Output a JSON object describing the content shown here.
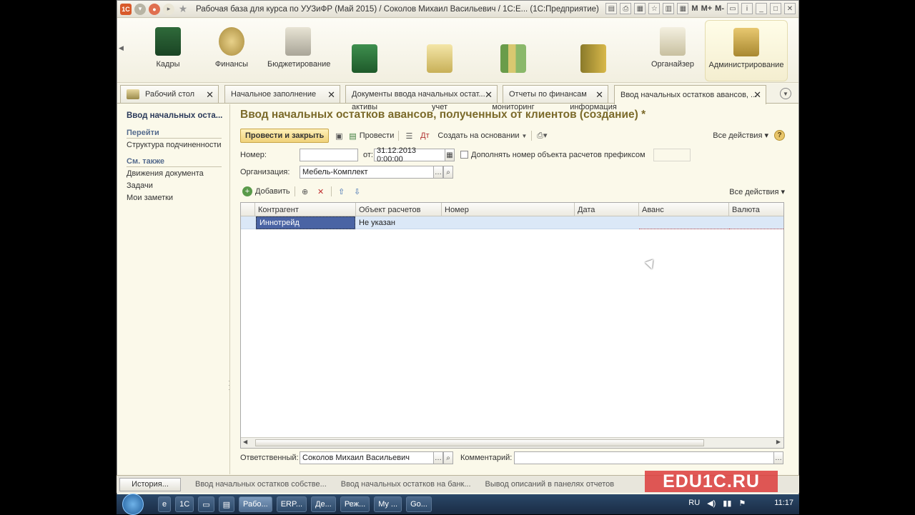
{
  "window": {
    "title": "Рабочая база для курса по УУЗиФР (Май 2015) / Соколов Михаил Васильевич / 1С:Е...   (1С:Предприятие)",
    "right_labels": [
      "M",
      "M+",
      "M-"
    ]
  },
  "ribbon": {
    "sections": [
      {
        "label": "Кадры"
      },
      {
        "label": "Финансы"
      },
      {
        "label": "Бюджетирование"
      },
      {
        "label": "Внеоборотные\nактивы"
      },
      {
        "label": "Регламентированный\nучет"
      },
      {
        "label": "Отчеты и\nмониторинг"
      },
      {
        "label": "Нормативно-справочная\nинформация"
      },
      {
        "label": "Органайзер"
      },
      {
        "label": "Администрирование"
      }
    ]
  },
  "tabs": [
    {
      "label": "Рабочий стол"
    },
    {
      "label": "Начальное заполнение"
    },
    {
      "label": "Документы ввода начальных остат..."
    },
    {
      "label": "Отчеты по финансам"
    },
    {
      "label": "Ввод начальных остатков авансов, ..."
    }
  ],
  "left_panel": {
    "title": "Ввод начальных оста...",
    "goto_header": "Перейти",
    "goto_links": [
      "Структура подчиненности"
    ],
    "see_also_header": "См. также",
    "see_also_links": [
      "Движения документа",
      "Задачи",
      "Мои заметки"
    ]
  },
  "document": {
    "title": "Ввод начальных остатков авансов, полученных от клиентов (создание) *",
    "toolbar": {
      "post_close": "Провести и закрыть",
      "post": "Провести",
      "create_based": "Создать на основании",
      "all_actions": "Все действия"
    },
    "fields": {
      "number_label": "Номер:",
      "number_value": "",
      "from_label": "от:",
      "date_value": "31.12.2013  0:00:00",
      "prefix_label": "Дополнять номер объекта расчетов префиксом",
      "org_label": "Организация:",
      "org_value": "Мебель-Комплект"
    },
    "table_toolbar": {
      "add": "Добавить",
      "all_actions": "Все действия"
    },
    "table": {
      "columns": [
        "Контрагент",
        "Объект расчетов",
        "Номер",
        "Дата",
        "Аванс",
        "Валюта"
      ],
      "rows": [
        {
          "counterparty": "Иннотрейд",
          "object": "Не указан",
          "number": "",
          "date": "",
          "advance": "",
          "currency": ""
        }
      ]
    },
    "footer": {
      "responsible_label": "Ответственный:",
      "responsible_value": "Соколов Михаил Васильевич",
      "comment_label": "Комментарий:",
      "comment_value": ""
    }
  },
  "history_bar": {
    "button": "История...",
    "items": [
      "Ввод начальных остатков собстве...",
      "Ввод начальных остатков на банк...",
      "Вывод описаний в панелях отчетов"
    ],
    "watermark": "EDU1C.RU"
  },
  "taskbar": {
    "tasks": [
      "Рабо...",
      "ERP...",
      "Де...",
      "Реж...",
      "My ...",
      "Go..."
    ],
    "lang": "RU",
    "time": "11:17"
  }
}
